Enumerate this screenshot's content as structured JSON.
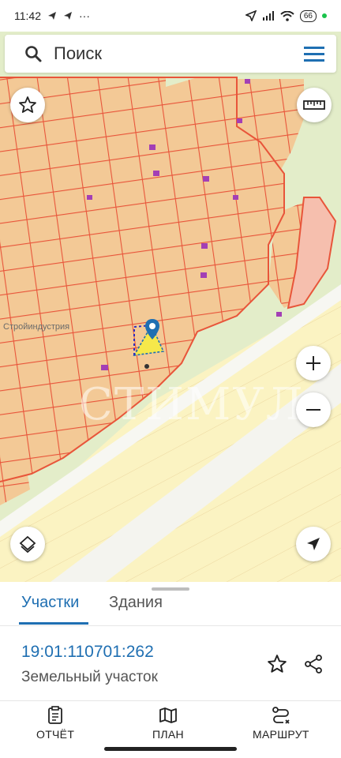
{
  "status_bar": {
    "time": "11:42",
    "dots": "···",
    "battery": "66"
  },
  "search": {
    "placeholder": "Поиск"
  },
  "map": {
    "watermark": "СТИМУЛ",
    "label": "Стройиндустрия"
  },
  "tabs": [
    {
      "label": "Участки",
      "active": true
    },
    {
      "label": "Здания",
      "active": false
    }
  ],
  "parcel": {
    "cadastral_number": "19:01:110701:262",
    "type": "Земельный участок"
  },
  "bottom_nav": {
    "report": "ОТЧЁТ",
    "plan": "ПЛАН",
    "route": "МАРШРУТ"
  },
  "colors": {
    "accent": "#1f6fb2",
    "parcel_fill": "#f3c996",
    "parcel_stroke": "#e8553a",
    "road": "#fbf3c2",
    "green": "#e3edc9"
  }
}
